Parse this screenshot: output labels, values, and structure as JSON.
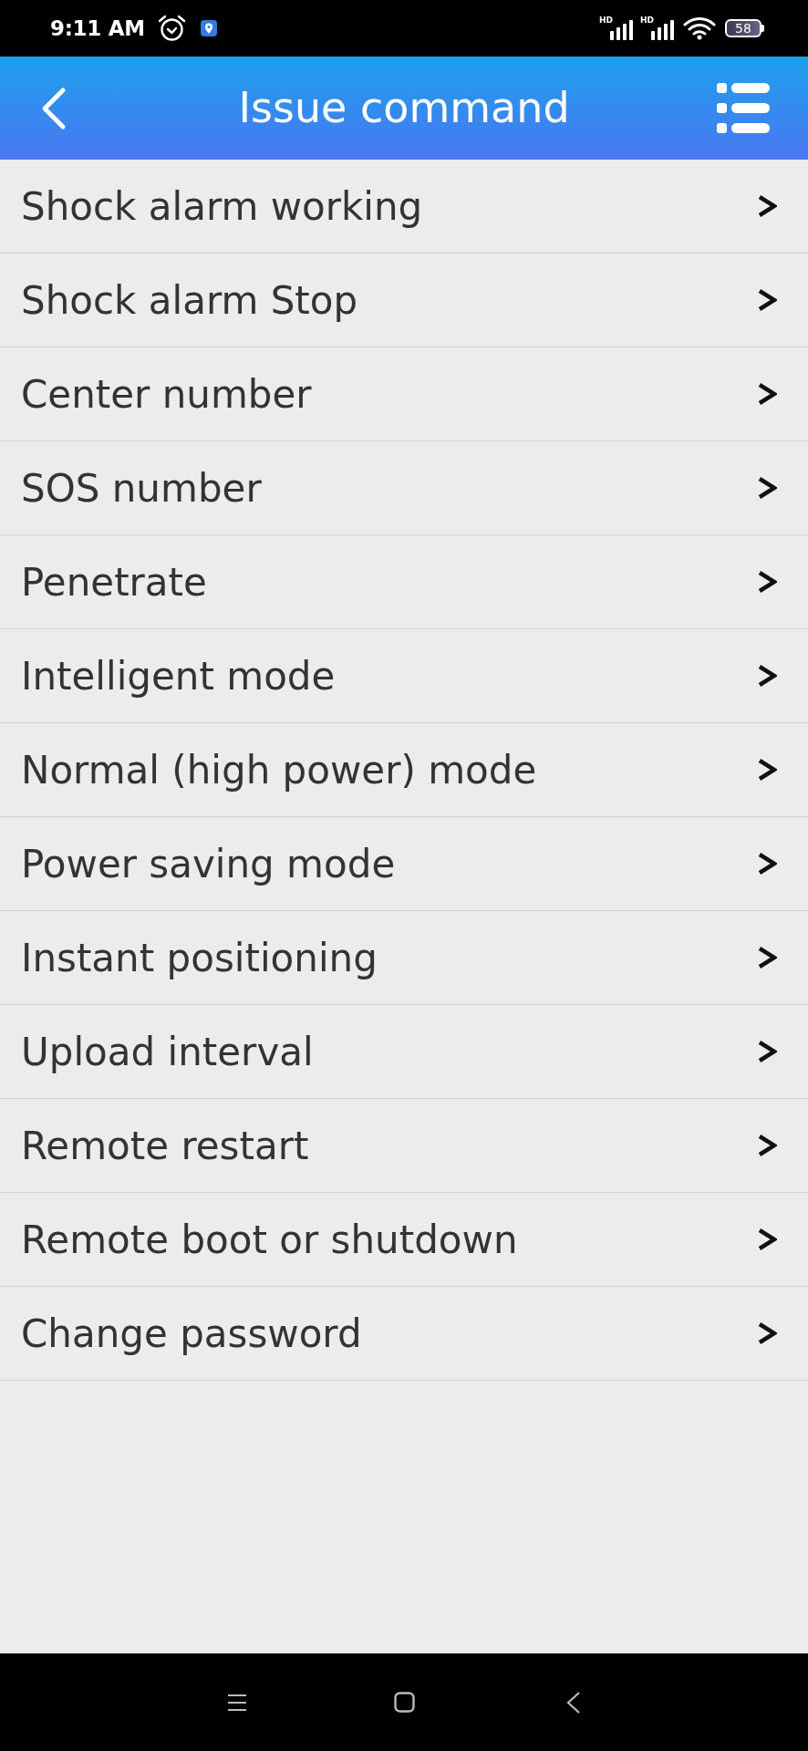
{
  "status_bar": {
    "time": "9:11 AM",
    "signals": [
      {
        "label": "HD"
      },
      {
        "label": "HD"
      }
    ],
    "battery": "58"
  },
  "header": {
    "title": "Issue command"
  },
  "commands": [
    "Shock alarm working",
    "Shock alarm Stop",
    "Center number",
    "SOS number",
    "Penetrate",
    "Intelligent mode",
    "Normal (high power) mode",
    "Power saving mode",
    "Instant positioning",
    "Upload interval",
    "Remote restart",
    "Remote boot or shutdown",
    "Change password"
  ]
}
